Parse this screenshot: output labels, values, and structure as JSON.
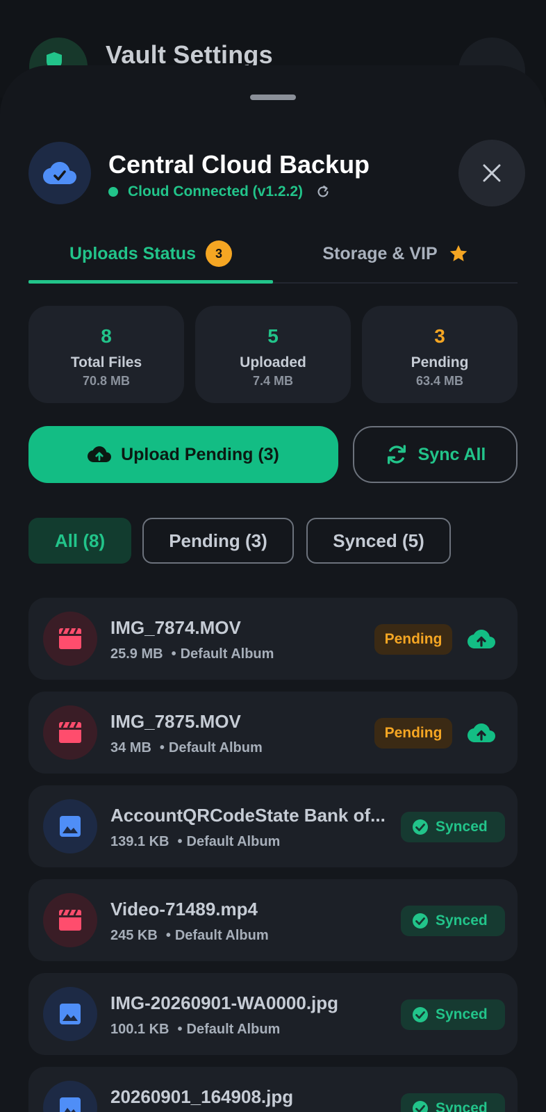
{
  "background": {
    "title": "Vault Settings"
  },
  "header": {
    "title": "Central Cloud Backup",
    "status": "Cloud Connected (v1.2.2)"
  },
  "tabs": [
    {
      "label": "Uploads Status",
      "badge": "3",
      "active": true
    },
    {
      "label": "Storage & VIP",
      "icon": "star-icon",
      "active": false
    }
  ],
  "stats": [
    {
      "value": "8",
      "label": "Total Files",
      "size": "70.8 MB",
      "color": "#22c48a"
    },
    {
      "value": "5",
      "label": "Uploaded",
      "size": "7.4 MB",
      "color": "#22c48a"
    },
    {
      "value": "3",
      "label": "Pending",
      "size": "63.4 MB",
      "color": "#f5a623"
    }
  ],
  "actions": {
    "upload_label": "Upload Pending (3)",
    "sync_label": "Sync All"
  },
  "filters": [
    {
      "label": "All (8)",
      "active": true
    },
    {
      "label": "Pending (3)",
      "active": false
    },
    {
      "label": "Synced (5)",
      "active": false
    }
  ],
  "files": [
    {
      "name": "IMG_7874.MOV",
      "size": "25.9 MB",
      "album": "Default Album",
      "type": "video",
      "status": "Pending"
    },
    {
      "name": "IMG_7875.MOV",
      "size": "34 MB",
      "album": "Default Album",
      "type": "video",
      "status": "Pending"
    },
    {
      "name": "AccountQRCodeState Bank of...",
      "size": "139.1 KB",
      "album": "Default Album",
      "type": "image",
      "status": "Synced"
    },
    {
      "name": "Video-71489.mp4",
      "size": "245 KB",
      "album": "Default Album",
      "type": "video",
      "status": "Synced"
    },
    {
      "name": "IMG-20260901-WA0000.jpg",
      "size": "100.1 KB",
      "album": "Default Album",
      "type": "image",
      "status": "Synced"
    },
    {
      "name": "20260901_164908.jpg",
      "size": "",
      "album": "",
      "type": "image",
      "status": "Synced"
    }
  ],
  "colors": {
    "accent": "#22c48a",
    "pending": "#f5a623",
    "video": "#ff4d6d",
    "image": "#4f8ef7"
  }
}
